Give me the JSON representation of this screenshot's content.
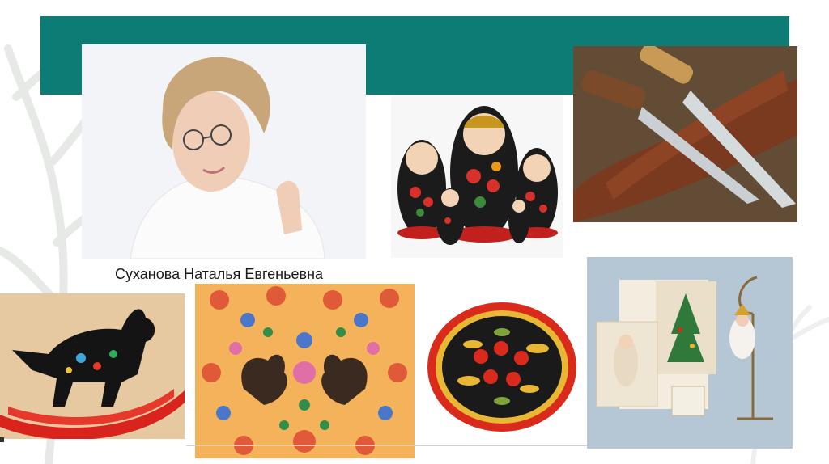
{
  "slide": {
    "caption": "Суханова Наталья Евгеньевна"
  },
  "colors": {
    "band": "#0c7c74",
    "background": "#ffffff"
  },
  "images": {
    "portrait": "portrait-photo",
    "dolls": "matryoshka-dolls-photo",
    "knives": "hunting-knives-photo",
    "horse": "painted-rocking-horse-photo",
    "painting": "folk-painting-roosters-photo",
    "plate": "khokhloma-plate-photo",
    "cards": "vintage-greeting-cards-photo"
  }
}
